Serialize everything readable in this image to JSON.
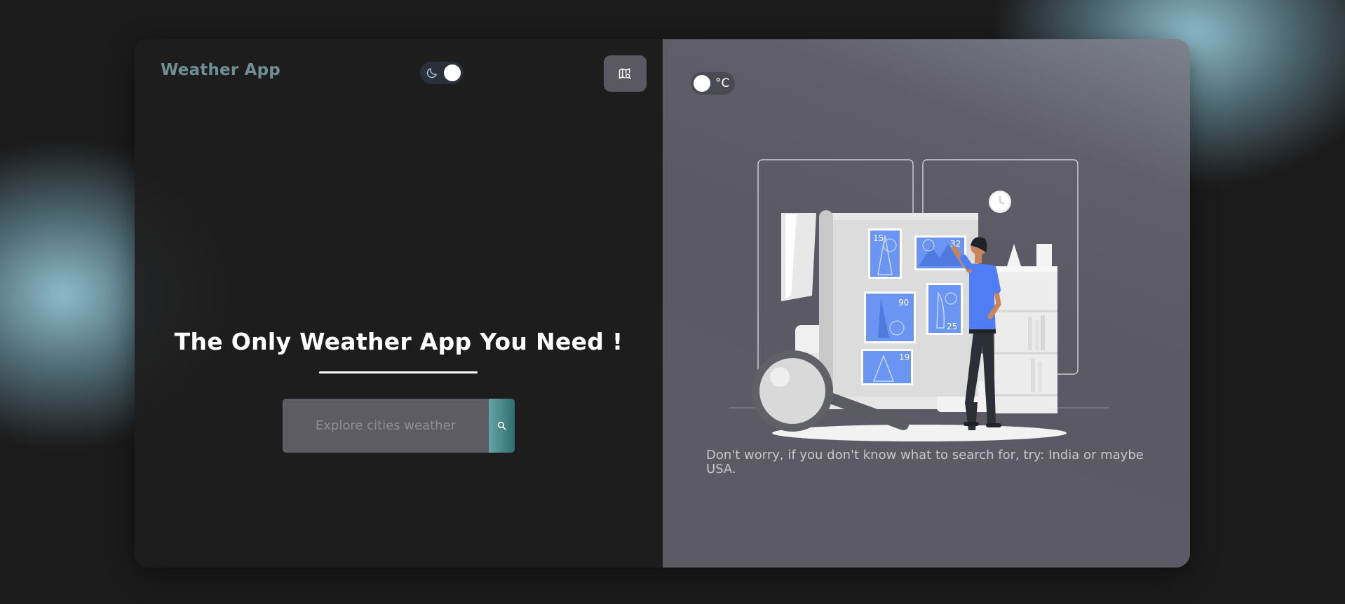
{
  "header": {
    "app_title": "Weather App",
    "theme_toggle": {
      "icon": "moon-icon",
      "state": "dark"
    },
    "map_button": {
      "icon": "map-search-icon"
    }
  },
  "hero": {
    "title": "The Only Weather App You Need !"
  },
  "search": {
    "placeholder": "Explore cities weather",
    "value": "",
    "button_icon": "search-icon"
  },
  "right_panel": {
    "unit_toggle": {
      "label": "°C"
    },
    "illustration": {
      "stamp_numbers": [
        "15",
        "32",
        "90",
        "25",
        "19"
      ]
    },
    "hint": "Don't worry, if you don't know what to search for, try: India or maybe USA."
  },
  "colors": {
    "background": "#1c1b1b",
    "accent_teal": "#6f8f92",
    "search_button": "#2e6f70",
    "right_panel": "#5b5963",
    "stamp_blue": "#5a8af0",
    "person_shirt": "#4f7df5"
  }
}
